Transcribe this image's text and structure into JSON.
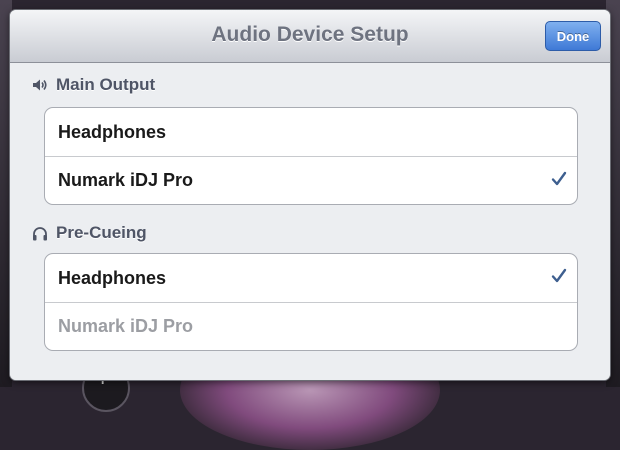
{
  "dialog": {
    "title": "Audio Device Setup",
    "done_label": "Done"
  },
  "sections": [
    {
      "header": "Main Output",
      "icon": "speaker-icon",
      "options": [
        {
          "label": "Headphones",
          "selected": false,
          "enabled": true
        },
        {
          "label": "Numark iDJ Pro",
          "selected": true,
          "enabled": true
        }
      ]
    },
    {
      "header": "Pre-Cueing",
      "icon": "headphones-icon",
      "options": [
        {
          "label": "Headphones",
          "selected": true,
          "enabled": true
        },
        {
          "label": "Numark iDJ Pro",
          "selected": false,
          "enabled": false
        }
      ]
    }
  ],
  "colors": {
    "accent": "#3f79d6",
    "checkmark": "#3e5f8f"
  }
}
